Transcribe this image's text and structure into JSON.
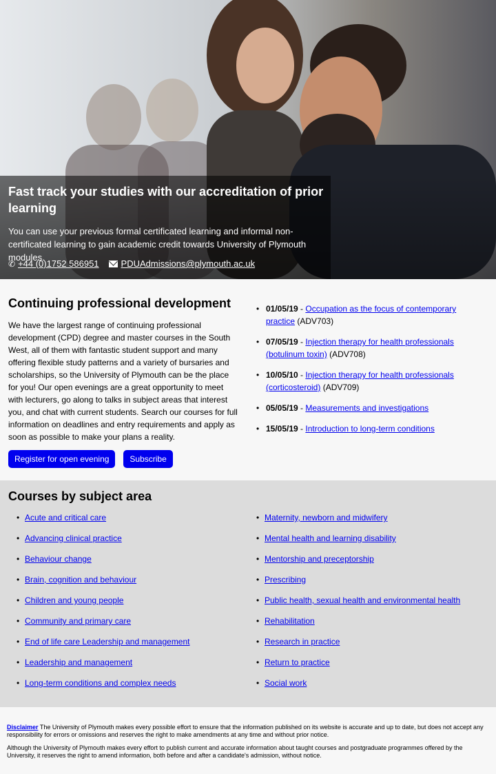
{
  "hero": {
    "title": "Fast track your studies with our accreditation of prior learning",
    "subtitle": "You can use your previous formal certificated learning and informal non-certificated learning to gain academic credit towards University of Plymouth modules.",
    "phone": "+44 (0)1752 586951",
    "email": "PDUAdmissions@plymouth.ac.uk"
  },
  "cpd": {
    "title": "Continuing professional development",
    "body": "We have the largest range of continuing professional development (CPD) degree and master courses in the South West, all of them with fantastic student support and many offering flexible study patterns and a variety of bursaries and scholarships, so the University of Plymouth can be the place for you! Our open evenings are a great opportunity to meet with lecturers, go along to talks in subject areas that interest you, and chat with current students. Search our courses for full information on deadlines and entry requirements and apply as soon as possible to make your plans a reality.",
    "register_label": "Register for open evening",
    "subscribe_label": "Subscribe",
    "events": [
      {
        "date": "01/05/19",
        "title": "Occupation as the focus of contemporary practice",
        "code": "(ADV703)"
      },
      {
        "date": "07/05/19",
        "title": "Injection therapy for health professionals (botulinum toxin)",
        "code": "(ADV708)"
      },
      {
        "date": "10/05/10",
        "title": "Injection therapy for health professionals (corticosteroid)",
        "code": "(ADV709)"
      },
      {
        "date": "05/05/19",
        "title": "Measurements and investigations",
        "code": ""
      },
      {
        "date": "15/05/19",
        "title": "Introduction to long-term conditions",
        "code": ""
      }
    ]
  },
  "courses": {
    "title": "Courses by subject area",
    "left": [
      "Acute and critical care",
      "Advancing clinical practice",
      "Behaviour change",
      "Brain, cognition and behaviour",
      "Children and young people",
      "Community and primary care",
      "End of life care Leadership and management",
      "Leadership and management",
      "Long-term conditions and complex needs"
    ],
    "right": [
      "Maternity, newborn and midwifery",
      "Mental health and learning disability",
      "Mentorship and preceptorship",
      "Prescribing",
      "Public health, sexual health and environmental health",
      "Rehabilitation",
      "Research in practice",
      "Return to practice",
      "Social work"
    ]
  },
  "footer": {
    "disclaimer_label": "Disclaimer",
    "disclaimer_text": "The University of Plymouth makes every possible effort to ensure that the information published on its website is accurate and up to date, but does not accept any responsibility for errors or omissions and reserves the right to make amendments at any time and without prior notice.",
    "note": "Although the University of Plymouth makes every effort to publish current and accurate information about taught courses and postgraduate programmes offered by the University, it reserves the right to amend information, both before and after a candidate's admission, without notice."
  }
}
